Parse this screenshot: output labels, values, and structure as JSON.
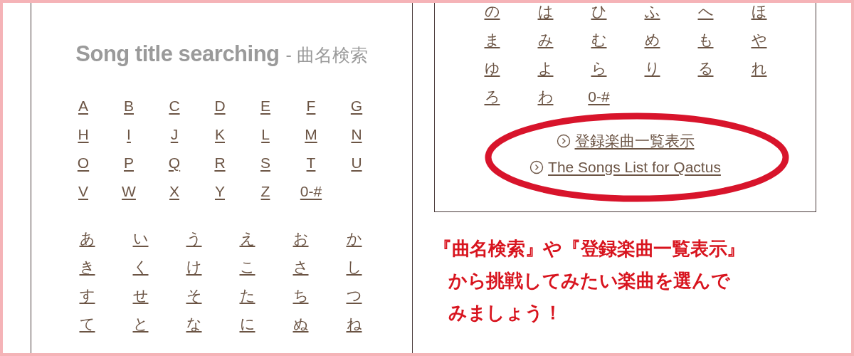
{
  "search_panel": {
    "title": "Song title searching",
    "title_suffix": "- 曲名検索",
    "alphabet": [
      [
        "A",
        "B",
        "C",
        "D",
        "E",
        "F",
        "G"
      ],
      [
        "H",
        "I",
        "J",
        "K",
        "L",
        "M",
        "N"
      ],
      [
        "O",
        "P",
        "Q",
        "R",
        "S",
        "T",
        "U"
      ],
      [
        "V",
        "W",
        "X",
        "Y",
        "Z",
        "0-#"
      ]
    ],
    "kana": [
      [
        "あ",
        "い",
        "う",
        "え",
        "お",
        "か"
      ],
      [
        "き",
        "く",
        "け",
        "こ",
        "さ",
        "し"
      ],
      [
        "す",
        "せ",
        "そ",
        "た",
        "ち",
        "つ"
      ],
      [
        "て",
        "と",
        "な",
        "に",
        "ぬ",
        "ね"
      ]
    ]
  },
  "list_panel": {
    "kana": [
      [
        "の",
        "は",
        "ひ",
        "ふ",
        "へ",
        "ほ"
      ],
      [
        "ま",
        "み",
        "む",
        "め",
        "も",
        "や"
      ],
      [
        "ゆ",
        "よ",
        "ら",
        "り",
        "る",
        "れ"
      ],
      [
        "ろ",
        "わ",
        "0-#"
      ]
    ],
    "links": [
      "登録楽曲一覧表示",
      "The Songs List for Qactus"
    ]
  },
  "caption": [
    "『曲名検索』や『登録楽曲一覧表示』",
    "から挑戦してみたい楽曲を選んで",
    "みましょう！"
  ]
}
